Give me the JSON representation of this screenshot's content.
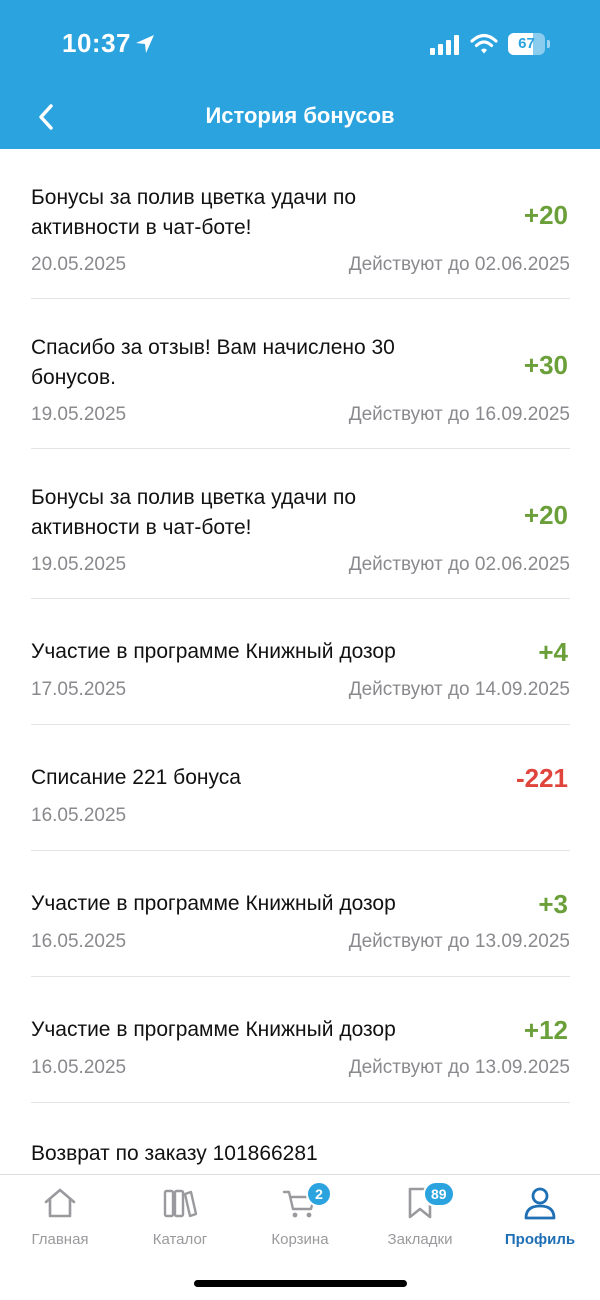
{
  "status_bar": {
    "time": "10:37",
    "battery_percent": 67,
    "battery_label": "67"
  },
  "header": {
    "title": "История бонусов"
  },
  "entries": [
    {
      "title": "Бонусы за полив цветка удачи по активности в чат-боте!",
      "amount": "+20",
      "sign": "plus",
      "date": "20.05.2025",
      "valid": "Действуют до 02.06.2025"
    },
    {
      "title": "Спасибо за отзыв! Вам начислено 30 бонусов.",
      "amount": "+30",
      "sign": "plus",
      "date": "19.05.2025",
      "valid": "Действуют до 16.09.2025"
    },
    {
      "title": "Бонусы за полив цветка удачи по активности в чат-боте!",
      "amount": "+20",
      "sign": "plus",
      "date": "19.05.2025",
      "valid": "Действуют до 02.06.2025"
    },
    {
      "title": "Участие в программе Книжный дозор",
      "amount": "+4",
      "sign": "plus",
      "date": "17.05.2025",
      "valid": "Действуют до 14.09.2025"
    },
    {
      "title": "Списание 221 бонуса",
      "amount": "-221",
      "sign": "minus",
      "date": "16.05.2025",
      "valid": ""
    },
    {
      "title": "Участие в программе Книжный дозор",
      "amount": "+3",
      "sign": "plus",
      "date": "16.05.2025",
      "valid": "Действуют до 13.09.2025"
    },
    {
      "title": "Участие в программе Книжный дозор",
      "amount": "+12",
      "sign": "plus",
      "date": "16.05.2025",
      "valid": "Действуют до 13.09.2025"
    },
    {
      "title": "Возврат по заказу 101866281",
      "amount": "",
      "sign": "plus",
      "date": "",
      "valid": ""
    }
  ],
  "tabbar": {
    "tabs": [
      {
        "label": "Главная",
        "icon": "home-icon"
      },
      {
        "label": "Каталог",
        "icon": "books-icon"
      },
      {
        "label": "Корзина",
        "icon": "cart-icon",
        "badge": "2"
      },
      {
        "label": "Закладки",
        "icon": "bookmark-icon",
        "badge": "89"
      },
      {
        "label": "Профиль",
        "icon": "profile-icon",
        "active": true
      }
    ]
  },
  "colors": {
    "header_bg": "#2aa3df",
    "plus": "#6a9f39",
    "minus": "#e0453d",
    "active_tab": "#1f6fb5"
  }
}
